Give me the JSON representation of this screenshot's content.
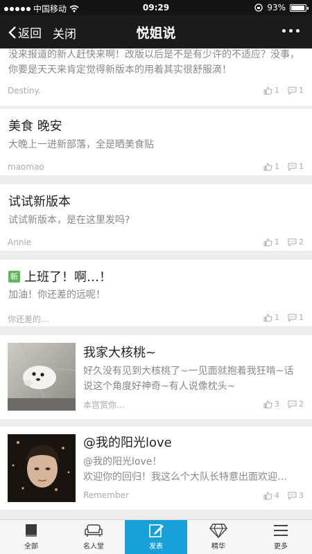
{
  "status": {
    "carrier": "中国移动",
    "time": "09:29",
    "battery": "93%",
    "battery_level": 0.93
  },
  "nav": {
    "back_label": "返回",
    "close_label": "关闭",
    "title": "悦姐说"
  },
  "posts": [
    {
      "title": "",
      "body": "没来报道的新人赶快来啊！改版以后是不是有少许的不适应？没事，你要是天天来肯定觉得新版本的用着其实很舒服滴！",
      "author": "Destiny.",
      "likes": "1",
      "comments": "1"
    },
    {
      "title": "美食 晚安",
      "body": "大晚上一进新部落，全是晒美食贴",
      "author": "maomao",
      "likes": "1",
      "comments": "1"
    },
    {
      "title": "试试新版本",
      "body": "试试新版本，是在这里发吗?",
      "author": "Annie",
      "likes": "1",
      "comments": "2"
    },
    {
      "badge": "新",
      "title": "上班了！啊…！",
      "body": "加油！你还差的远呢！",
      "author": "你还差的…",
      "likes": "1",
      "comments": "1"
    },
    {
      "title": "我家大核桃~",
      "body": "好久没有见到大核桃了~一见面就抱着我狂啃~话说这个角度好神奇~有人说像枕头~",
      "author": "本宫赏你…",
      "likes": "3",
      "comments": "2"
    },
    {
      "title": "@我的阳光love",
      "body_line1": "@我的阳光love！",
      "body_line2": "欢迎你的回归！我这么个大队长特意出面欢迎…",
      "author": "Remember",
      "likes": "4",
      "comments": "3"
    }
  ],
  "tabs": [
    {
      "label": "全部",
      "icon": "book-icon"
    },
    {
      "label": "名人堂",
      "icon": "sofa-icon"
    },
    {
      "label": "发表",
      "icon": "edit-icon"
    },
    {
      "label": "精华",
      "icon": "diamond-icon"
    },
    {
      "label": "更多",
      "icon": "menu-icon"
    }
  ],
  "colors": {
    "accent": "#18a0d9",
    "new_badge": "#5cb85c",
    "navbar": "#1b1b1b"
  }
}
